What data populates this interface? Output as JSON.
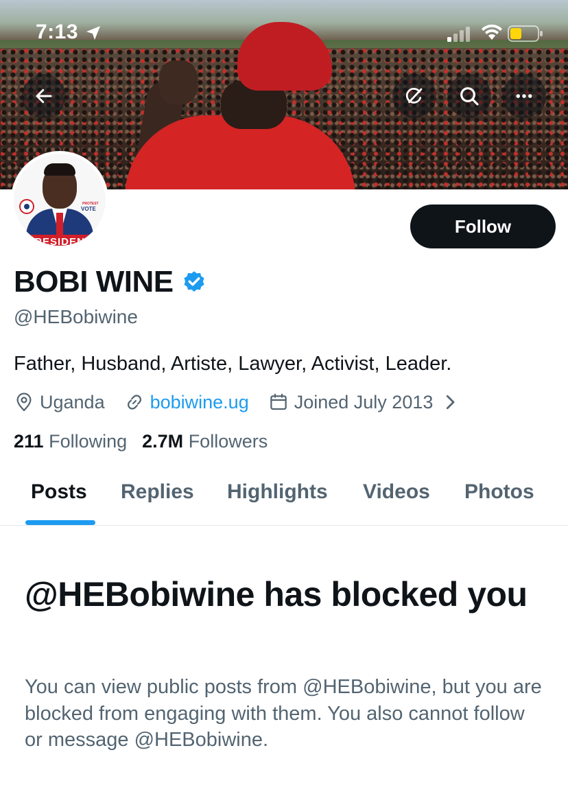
{
  "status_bar": {
    "time": "7:13"
  },
  "banner": {
    "buttons": [
      "back",
      "grok",
      "search",
      "more"
    ]
  },
  "avatar": {
    "banner_text": "RESIDEN",
    "protest_text": "PROTEST",
    "vote_text": "VOTE"
  },
  "profile": {
    "follow_label": "Follow",
    "display_name": "BOBI WINE",
    "verified": true,
    "handle": "@HEBobiwine",
    "bio": "Father, Husband, Artiste, Lawyer, Activist, Leader.",
    "location": "Uganda",
    "website": "bobiwine.ug",
    "joined": "Joined July 2013",
    "following_count": "211",
    "following_label": "Following",
    "followers_count": "2.7M",
    "followers_label": "Followers"
  },
  "tabs": [
    {
      "label": "Posts",
      "active": true
    },
    {
      "label": "Replies",
      "active": false
    },
    {
      "label": "Highlights",
      "active": false
    },
    {
      "label": "Videos",
      "active": false
    },
    {
      "label": "Photos",
      "active": false
    }
  ],
  "blocked": {
    "title": "@HEBobiwine has blocked you",
    "body": "You can view public posts from @HEBobiwine, but you are blocked from engaging with them. You also cannot follow or message @HEBobiwine."
  },
  "colors": {
    "accent": "#1d9bf0",
    "text_primary": "#0f1419",
    "text_secondary": "#536471",
    "follow_button": "#0f1419"
  },
  "icons": {
    "back": "arrow-left-icon",
    "grok": "grok-icon",
    "search": "search-icon",
    "more": "more-dots-icon",
    "verified": "verified-badge-icon",
    "location": "location-pin-icon",
    "link": "link-icon",
    "calendar": "calendar-icon"
  }
}
